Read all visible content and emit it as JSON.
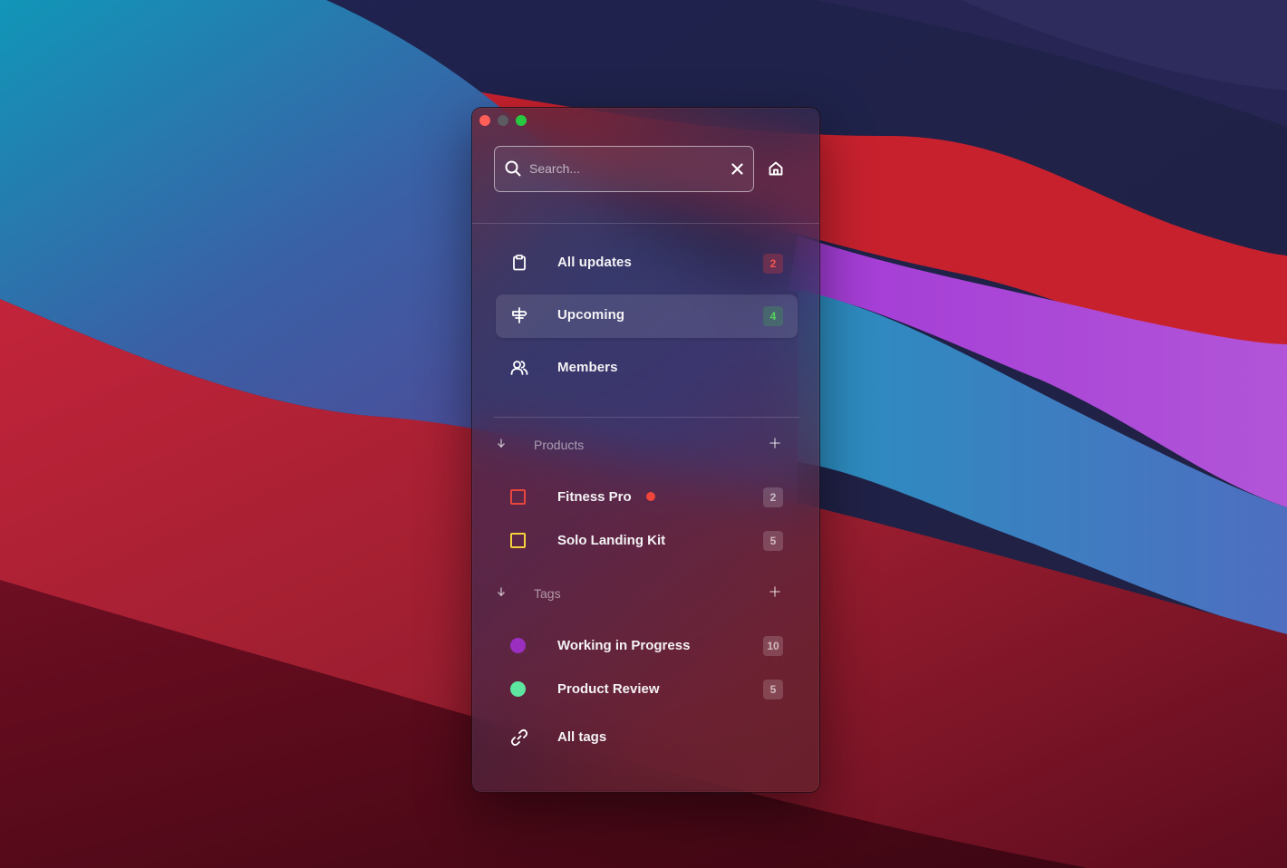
{
  "window": {
    "traffic_lights": [
      "close",
      "minimize",
      "zoom"
    ]
  },
  "search": {
    "placeholder": "Search...",
    "value": ""
  },
  "nav": [
    {
      "label": "All updates",
      "icon": "clipboard-icon",
      "badge": "2",
      "badge_color": "red"
    },
    {
      "label": "Upcoming",
      "icon": "signpost-icon",
      "badge": "4",
      "badge_color": "green",
      "active": true
    },
    {
      "label": "Members",
      "icon": "users-icon"
    }
  ],
  "products": {
    "title": "Products",
    "items": [
      {
        "label": "Fitness Pro",
        "color": "#e8453c",
        "count": "2",
        "notification": true
      },
      {
        "label": "Solo Landing Kit",
        "color": "#f5d23c",
        "count": "5"
      }
    ]
  },
  "tags": {
    "title": "Tags",
    "items": [
      {
        "label": "Working in Progress",
        "color": "#9a2fc0",
        "count": "10"
      },
      {
        "label": "Product Review",
        "color": "#5ee5a0",
        "count": "5"
      }
    ],
    "all_label": "All tags"
  },
  "colors": {
    "accent_red": "#f2564f",
    "accent_green": "#5ad35f"
  }
}
